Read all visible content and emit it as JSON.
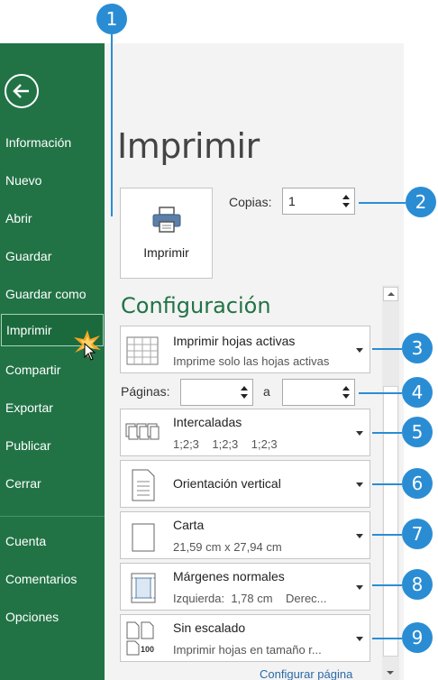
{
  "nav": {
    "items": [
      {
        "label": "Información"
      },
      {
        "label": "Nuevo"
      },
      {
        "label": "Abrir"
      },
      {
        "label": "Guardar"
      },
      {
        "label": "Guardar como"
      },
      {
        "label": "Imprimir"
      },
      {
        "label": "Compartir"
      },
      {
        "label": "Exportar"
      },
      {
        "label": "Publicar"
      },
      {
        "label": "Cerrar"
      },
      {
        "label": "Cuenta"
      },
      {
        "label": "Comentarios"
      },
      {
        "label": "Opciones"
      }
    ],
    "active": "Imprimir"
  },
  "page": {
    "title": "Imprimir",
    "print_button": "Imprimir",
    "copies_label": "Copias:",
    "copies_value": "1",
    "section_title": "Configuración",
    "pages_label": "Páginas:",
    "pages_to": "a",
    "pages_from_value": "",
    "pages_to_value": "",
    "configure_link": "Configurar página"
  },
  "settings": {
    "scope": {
      "title": "Imprimir hojas activas",
      "subtitle": "Imprime solo las hojas activas"
    },
    "collate": {
      "title": "Intercaladas",
      "subtitle": "1;2;3    1;2;3    1;2;3"
    },
    "orientation": {
      "title": "Orientación vertical"
    },
    "paper": {
      "title": "Carta",
      "subtitle": "21,59 cm x 27,94 cm"
    },
    "margins": {
      "title": "Márgenes normales",
      "subtitle": "Izquierda:  1,78 cm    Derec..."
    },
    "scaling": {
      "title": "Sin escalado",
      "subtitle": "Imprimir hojas en tamaño r..."
    }
  },
  "callouts": [
    "1",
    "2",
    "3",
    "4",
    "5",
    "6",
    "7",
    "8",
    "9"
  ],
  "colors": {
    "brand": "#217346",
    "callout": "#2a8dd4"
  }
}
